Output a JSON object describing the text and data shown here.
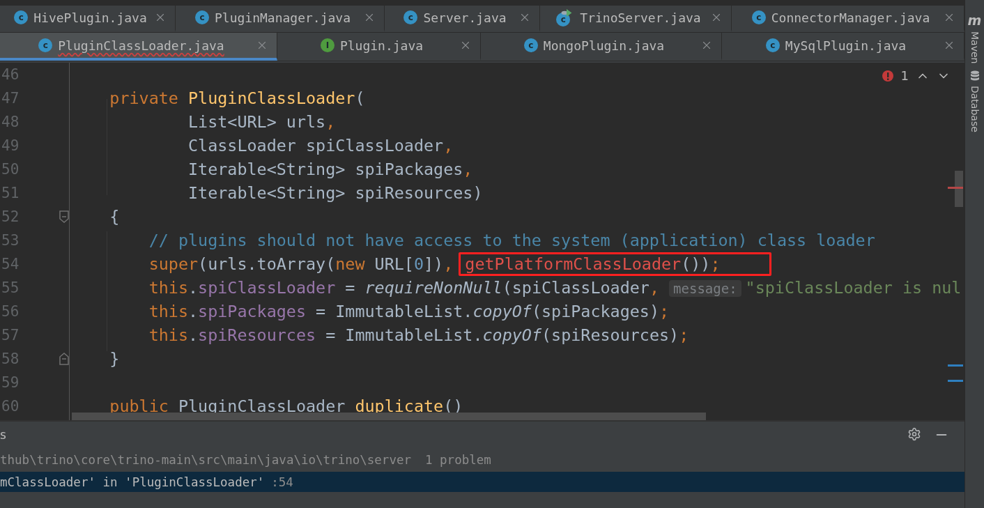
{
  "tab_rows": [
    [
      {
        "label": "HivePlugin.java",
        "icon_letter": "c",
        "kind": "class",
        "selected": false
      },
      {
        "label": "PluginManager.java",
        "icon_letter": "c",
        "kind": "class",
        "selected": false
      },
      {
        "label": "Server.java",
        "icon_letter": "c",
        "kind": "class",
        "selected": false
      },
      {
        "label": "TrinoServer.java",
        "icon_letter": "c",
        "kind": "runnable",
        "selected": false
      },
      {
        "label": "ConnectorManager.java",
        "icon_letter": "c",
        "kind": "class",
        "selected": false
      }
    ],
    [
      {
        "label": "PluginClassLoader.java",
        "icon_letter": "c",
        "kind": "class",
        "selected": true,
        "error": true
      },
      {
        "label": "Plugin.java",
        "icon_letter": "I",
        "kind": "interface",
        "selected": false,
        "error": false
      },
      {
        "label": "MongoPlugin.java",
        "icon_letter": "c",
        "kind": "class",
        "selected": false,
        "error": false
      },
      {
        "label": "MySqlPlugin.java",
        "icon_letter": "c",
        "kind": "class",
        "selected": false,
        "error": false
      }
    ]
  ],
  "editor": {
    "problem_count": "1",
    "lines": [
      {
        "number": "46"
      },
      {
        "number": "47",
        "tokens": [
          {
            "text": "    private ",
            "kind": "keyword"
          },
          {
            "text": "PluginClassLoader",
            "kind": "method"
          },
          {
            "text": "(",
            "kind": "plain"
          }
        ]
      },
      {
        "number": "48",
        "tokens": [
          {
            "text": "            List<URL> urls",
            "kind": "plain"
          },
          {
            "text": ",",
            "kind": "punct"
          }
        ]
      },
      {
        "number": "49",
        "tokens": [
          {
            "text": "            ClassLoader spiClassLoader",
            "kind": "plain"
          },
          {
            "text": ",",
            "kind": "punct"
          }
        ]
      },
      {
        "number": "50",
        "tokens": [
          {
            "text": "            Iterable<String> spiPackages",
            "kind": "plain"
          },
          {
            "text": ",",
            "kind": "punct"
          }
        ]
      },
      {
        "number": "51",
        "tokens": [
          {
            "text": "            Iterable<String> spiResources)",
            "kind": "plain"
          }
        ]
      },
      {
        "number": "52",
        "fold": true,
        "tokens": [
          {
            "text": "    {",
            "kind": "plain"
          }
        ]
      },
      {
        "number": "53",
        "tokens": [
          {
            "text": "        // plugins should not have access to the system (application) class loader",
            "kind": "comment"
          }
        ]
      },
      {
        "number": "54",
        "tokens": [
          {
            "text": "        super",
            "kind": "keyword"
          },
          {
            "text": "(urls.toArray(",
            "kind": "plain"
          },
          {
            "text": "new",
            "kind": "keyword"
          },
          {
            "text": " URL[",
            "kind": "plain"
          },
          {
            "text": "0",
            "kind": "number"
          },
          {
            "text": "])",
            "kind": "plain"
          },
          {
            "text": ", ",
            "kind": "punct"
          },
          {
            "text": "getPlatformClassLoader",
            "kind": "error",
            "boxed": true
          },
          {
            "text": "())",
            "kind": "plain",
            "boxed": true
          },
          {
            "text": ";",
            "kind": "punct",
            "boxed": true
          }
        ]
      },
      {
        "number": "55",
        "tokens": [
          {
            "text": "        this",
            "kind": "keyword"
          },
          {
            "text": ".",
            "kind": "plain"
          },
          {
            "text": "spiClassLoader",
            "kind": "field"
          },
          {
            "text": " = ",
            "kind": "plain"
          },
          {
            "text": "requireNonNull",
            "kind": "static"
          },
          {
            "text": "(spiClassLoader",
            "kind": "plain"
          },
          {
            "text": ", ",
            "kind": "punct"
          },
          {
            "text": "message:",
            "kind": "hint"
          },
          {
            "text": "\"spiClassLoader is nul",
            "kind": "string"
          }
        ]
      },
      {
        "number": "56",
        "tokens": [
          {
            "text": "        this",
            "kind": "keyword"
          },
          {
            "text": ".",
            "kind": "plain"
          },
          {
            "text": "spiPackages",
            "kind": "field"
          },
          {
            "text": " = ImmutableList.",
            "kind": "plain"
          },
          {
            "text": "copyOf",
            "kind": "static"
          },
          {
            "text": "(spiPackages)",
            "kind": "plain"
          },
          {
            "text": ";",
            "kind": "punct"
          }
        ]
      },
      {
        "number": "57",
        "tokens": [
          {
            "text": "        this",
            "kind": "keyword"
          },
          {
            "text": ".",
            "kind": "plain"
          },
          {
            "text": "spiResources",
            "kind": "field"
          },
          {
            "text": " = ImmutableList.",
            "kind": "plain"
          },
          {
            "text": "copyOf",
            "kind": "static"
          },
          {
            "text": "(spiResources)",
            "kind": "plain"
          },
          {
            "text": ";",
            "kind": "punct"
          }
        ]
      },
      {
        "number": "58",
        "fold": true,
        "tokens": [
          {
            "text": "    }",
            "kind": "plain"
          }
        ]
      },
      {
        "number": "59"
      },
      {
        "number": "60",
        "tokens": [
          {
            "text": "    public",
            "kind": "keyword"
          },
          {
            "text": " PluginClassLoader ",
            "kind": "plain"
          },
          {
            "text": "duplicate",
            "kind": "method"
          },
          {
            "text": "()",
            "kind": "plain"
          }
        ]
      }
    ]
  },
  "problems_panel": {
    "title": "s",
    "path": "thub\\trino\\core\\trino-main\\src\\main\\java\\io\\trino\\server",
    "count": "1 problem",
    "rows": [
      {
        "message": "mClassLoader' in 'PluginClassLoader'",
        "line": ":54",
        "selected": true
      }
    ]
  },
  "right_sidebar": [
    {
      "label": "Maven",
      "kind": "maven",
      "icon_letter": "m"
    },
    {
      "label": "Database",
      "kind": "database"
    }
  ]
}
